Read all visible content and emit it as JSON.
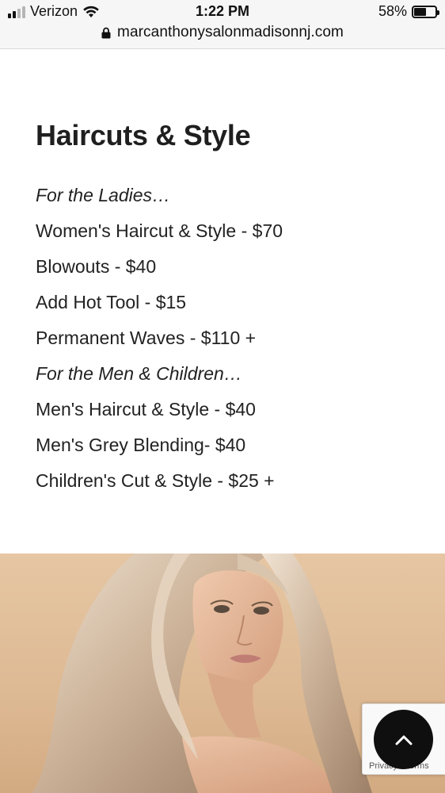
{
  "status_bar": {
    "carrier": "Verizon",
    "time": "1:22 PM",
    "battery_percent": "58%",
    "battery_level": 0.58,
    "icons": [
      "signal-icon",
      "wifi-icon",
      "battery-icon"
    ]
  },
  "browser": {
    "url": "marcanthonysalonmadisonnj.com",
    "icons": [
      "lock-icon"
    ]
  },
  "page": {
    "title": "Haircuts & Style",
    "menu": [
      {
        "text": "For the Ladies…",
        "italic": true
      },
      {
        "text": "Women's Haircut & Style - $70",
        "italic": false
      },
      {
        "text": "Blowouts - $40",
        "italic": false
      },
      {
        "text": "Add Hot Tool - $15",
        "italic": false
      },
      {
        "text": "Permanent Waves - $110 +",
        "italic": false
      },
      {
        "text": "For the Men & Children…",
        "italic": true
      },
      {
        "text": "Men's Haircut & Style - $40",
        "italic": false
      },
      {
        "text": "Men's Grey Blending- $40",
        "italic": false
      },
      {
        "text": "Children's Cut & Style - $25 +",
        "italic": false
      }
    ]
  },
  "recaptcha": {
    "privacy": "Privacy",
    "separator": " - ",
    "terms": "Terms"
  },
  "scroll_top": {
    "icon": "chevron-up-icon"
  },
  "colors": {
    "text": "#1f1f1f",
    "hero_background": "#e3c29e",
    "scroll_button": "#0f0f0f"
  }
}
